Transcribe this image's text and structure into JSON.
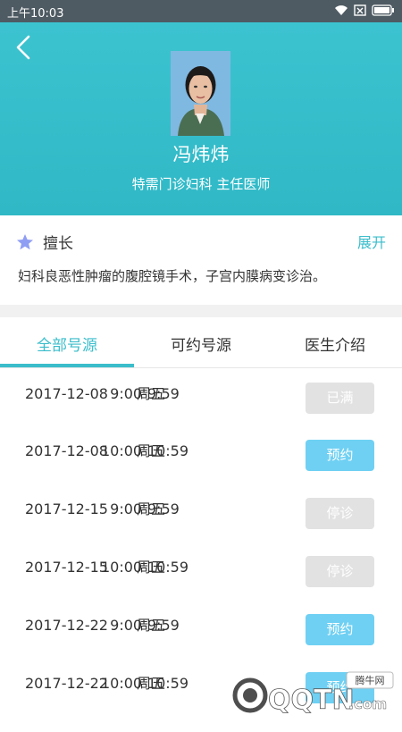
{
  "status_bar": {
    "time": "上午10:03"
  },
  "doctor": {
    "name": "冯炜炜",
    "title": "特需门诊妇科 主任医师"
  },
  "expertise": {
    "label": "擅长",
    "expand_label": "展开",
    "text": "妇科良恶性肿瘤的腹腔镜手术，子宫内膜病变诊治。"
  },
  "tabs": [
    {
      "label": "全部号源",
      "active": true
    },
    {
      "label": "可约号源",
      "active": false
    },
    {
      "label": "医生介绍",
      "active": false
    }
  ],
  "schedule": [
    {
      "date": "2017-12-08",
      "weekday": "周五",
      "time": "9:00-9:59",
      "status": "已满"
    },
    {
      "date": "2017-12-08",
      "weekday": "周五",
      "time": "10:00-10:59",
      "status": "预约"
    },
    {
      "date": "2017-12-15",
      "weekday": "周五",
      "time": "9:00-9:59",
      "status": "停诊"
    },
    {
      "date": "2017-12-15",
      "weekday": "周五",
      "time": "10:00-10:59",
      "status": "停诊"
    },
    {
      "date": "2017-12-22",
      "weekday": "周五",
      "time": "9:00-9:59",
      "status": "预约"
    },
    {
      "date": "2017-12-22",
      "weekday": "周五",
      "time": "10:00-10:59",
      "status": "预约"
    }
  ],
  "watermark": {
    "brand": "QQTN",
    "suffix": ".com",
    "badge": "腾牛网"
  },
  "colors": {
    "accent": "#3bbdcb",
    "book_button": "#6fd0f3",
    "disabled_button": "#e2e2e2"
  }
}
